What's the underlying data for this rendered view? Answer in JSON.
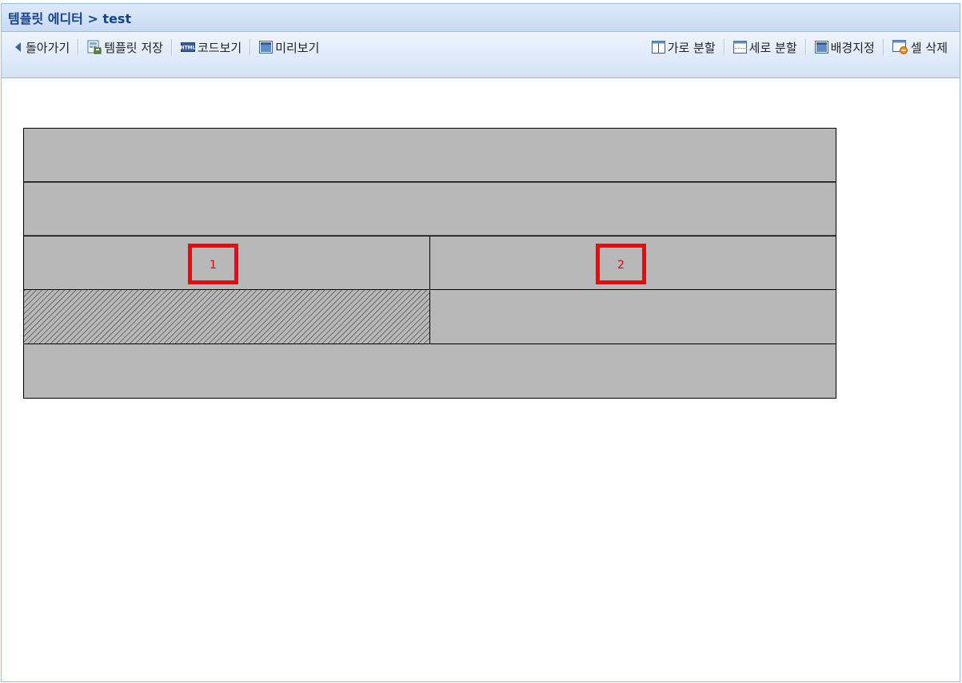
{
  "window": {
    "title": "템플릿 에디터 > test"
  },
  "toolbar": {
    "left": [
      {
        "label": "돌아가기",
        "icon": "back-arrow-icon"
      },
      {
        "label": "템플릿 저장",
        "icon": "save-template-icon"
      },
      {
        "label": "코드보기",
        "icon": "html-code-icon"
      },
      {
        "label": "미리보기",
        "icon": "preview-window-icon"
      }
    ],
    "right": [
      {
        "label": "가로 분할",
        "icon": "split-horizontal-icon"
      },
      {
        "label": "세로 분할",
        "icon": "split-vertical-icon"
      },
      {
        "label": "배경지정",
        "icon": "background-icon"
      },
      {
        "label": "셀 삭제",
        "icon": "delete-cell-icon"
      }
    ]
  },
  "editor": {
    "cell_fill": "#b8b8b8",
    "selected_pattern": "hatched",
    "markers": [
      {
        "label": "1",
        "color": "#ff0000"
      },
      {
        "label": "2",
        "color": "#ff0000"
      }
    ]
  }
}
